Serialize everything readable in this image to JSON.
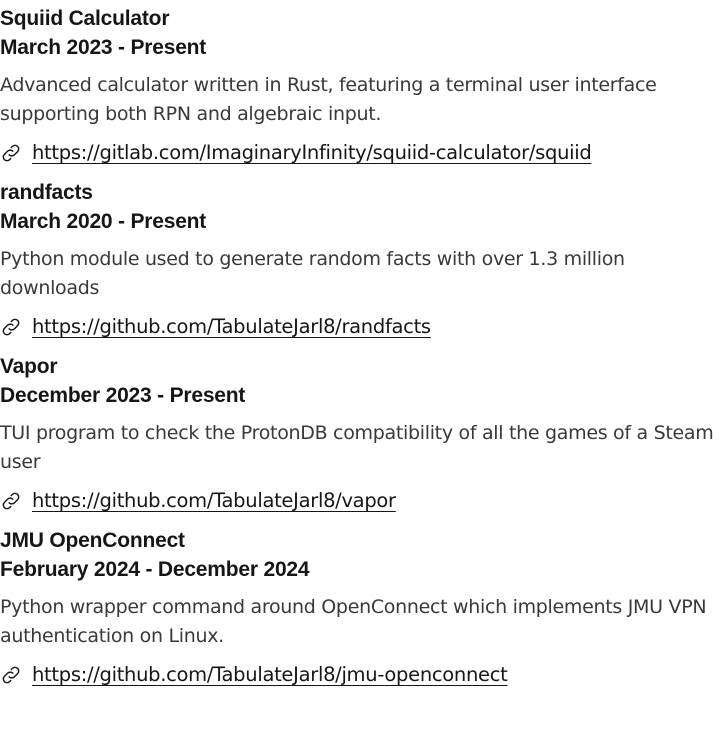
{
  "projects": [
    {
      "title": "Squiid Calculator",
      "dates": "March 2023 - Present",
      "description": "Advanced calculator written in Rust, featuring a terminal user interface supporting both RPN and algebraic input.",
      "link": "https://gitlab.com/ImaginaryInfinity/squiid-calculator/squiid"
    },
    {
      "title": "randfacts",
      "dates": "March 2020 - Present",
      "description": "Python module used to generate random facts with over 1.3 million downloads",
      "link": "https://github.com/TabulateJarl8/randfacts"
    },
    {
      "title": "Vapor",
      "dates": "December 2023 - Present",
      "description": "TUI program to check the ProtonDB compatibility of all the games of a Steam user",
      "link": "https://github.com/TabulateJarl8/vapor"
    },
    {
      "title": "JMU OpenConnect",
      "dates": "February 2024 - December 2024",
      "description": "Python wrapper command around OpenConnect which implements JMU VPN authentication on Linux.",
      "link": "https://github.com/TabulateJarl8/jmu-openconnect"
    }
  ],
  "icons": {
    "link": "link-icon"
  }
}
